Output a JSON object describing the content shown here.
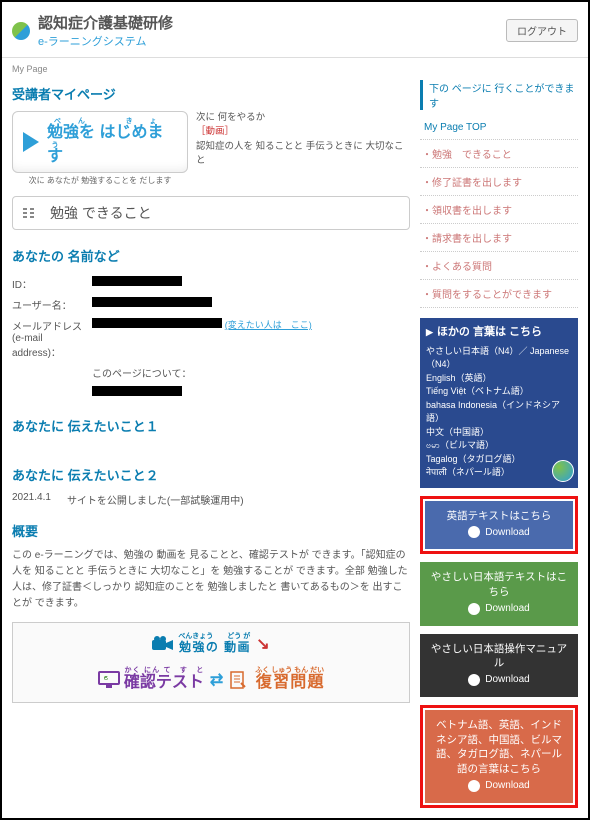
{
  "header": {
    "title": "認知症介護基礎研修",
    "subtitle": "e-ラーニングシステム",
    "logout": "ログアウト"
  },
  "crumb": "My Page",
  "mypage_title": "受講者マイページ",
  "study": {
    "btn_ruby": "べん　きょう",
    "btn_text": "勉強を はじめます",
    "btn_sub": "次に あなたが 勉強することを だします",
    "next_label": "次に 何をやるか",
    "movie_tag": "［動画］",
    "next_desc": "認知症の人を 知ることと 手伝うときに 大切なこと"
  },
  "skill_label": "勉強 できること",
  "profile": {
    "heading": "あなたの 名前など",
    "id_k": "ID：",
    "user_k": "ユーザー名：",
    "mail_k": "メールアドレス (e-mail address)：",
    "page_note": "このページについて：",
    "change_link": "(変えたい人は　ここ)"
  },
  "msg1": {
    "heading": "あなたに 伝えたいこと１"
  },
  "msg2": {
    "heading": "あなたに 伝えたいこと２",
    "date": "2021.4.1",
    "text": "サイトを公開しました(一部試験運用中)"
  },
  "overview": {
    "heading": "概要",
    "body": "この e-ラーニングでは、勉強の 動画を 見ることと、確認テストが できます。「認知症の人を 知ることと 手伝うときに 大切なこと」を 勉強することが できます。全部 勉強した 人は、修了証書＜しっかり 認知症のことを 勉強しましたと 書いてあるもの＞を 出すことが できます。"
  },
  "flow": {
    "video_ruby": "べんきょう　　どう が",
    "video": "勉強の 動画",
    "test_ruby": "かく にん  て　す　と",
    "test": "確認テスト",
    "review_ruby": "ふく しゅう もん だい",
    "review": "復習問題"
  },
  "side": {
    "nav_head": "下の ページに 行くことができます",
    "items": [
      "My Page TOP",
      "勉強　できること",
      "修了証書を出します",
      "領収書を出します",
      "請求書を出します",
      "よくある質問",
      "質問をすることができます"
    ],
    "lang_head": "ほかの 言葉は こちら",
    "lang_lines": [
      "やさしい日本語（N4）／ Japanese（N4）",
      "English（英語）",
      "Tiếng Việt（ベトナム語）",
      "bahasa Indonesia（インドネシア語）",
      "中文（中国語）",
      "ဗမာ（ビルマ語）",
      "Tagalog（タガログ語）",
      "नेपाली（ネパール語）"
    ],
    "cards": {
      "en": {
        "title": "英語テキストはこちら",
        "dl": "Download"
      },
      "easyjp": {
        "title": "やさしい日本語テキストはこちら",
        "dl": "Download"
      },
      "manual": {
        "title": "やさしい日本語操作マニュアル",
        "dl": "Download"
      },
      "multi": {
        "title": "ベトナム語、英語、インドネシア語、中国語、ビルマ語、タガログ語、ネパール語の言葉はこちら",
        "dl": "Download"
      }
    }
  }
}
